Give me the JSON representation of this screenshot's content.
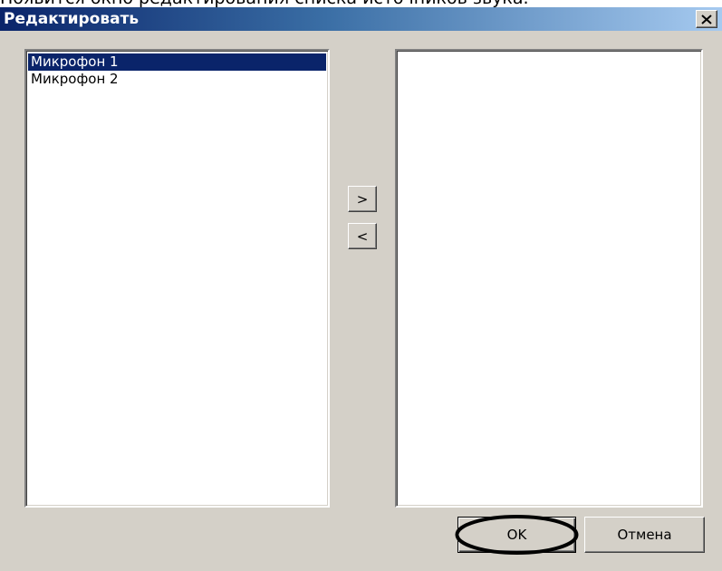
{
  "document": {
    "caption": "Появится окно редактирования списка источников звука."
  },
  "dialog": {
    "title": "Редактировать",
    "close_label": "Close"
  },
  "available_list": {
    "items": [
      {
        "label": "Микрофон 1",
        "selected": true
      },
      {
        "label": "Микрофон 2",
        "selected": false
      }
    ]
  },
  "selected_list": {
    "items": []
  },
  "transfer": {
    "add_label": ">",
    "remove_label": "<"
  },
  "footer": {
    "ok_label": "OK",
    "cancel_label": "Отмена"
  },
  "colors": {
    "face": "#d4d0c8",
    "titlebar_start": "#0a246a",
    "titlebar_end": "#a6caf0",
    "selection": "#0a246a"
  },
  "icons": {
    "close": "close-icon"
  }
}
